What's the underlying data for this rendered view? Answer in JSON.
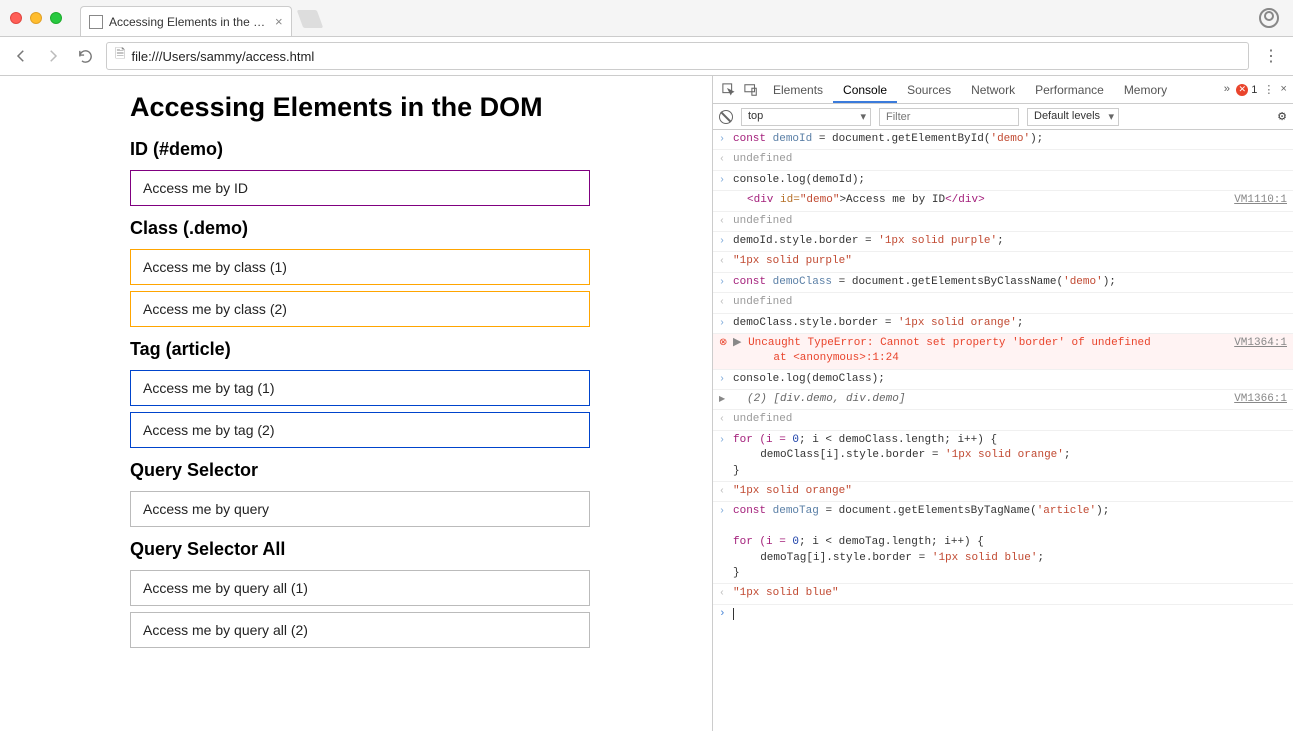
{
  "chrome": {
    "tab_title": "Accessing Elements in the DOM",
    "url": "file:///Users/sammy/access.html"
  },
  "page": {
    "h1": "Accessing Elements in the DOM",
    "sections": [
      {
        "heading": "ID (#demo)",
        "boxes": [
          {
            "text": "Access me by ID",
            "style": "purple"
          }
        ]
      },
      {
        "heading": "Class (.demo)",
        "boxes": [
          {
            "text": "Access me by class (1)",
            "style": "orange"
          },
          {
            "text": "Access me by class (2)",
            "style": "orange"
          }
        ]
      },
      {
        "heading": "Tag (article)",
        "boxes": [
          {
            "text": "Access me by tag (1)",
            "style": "blue"
          },
          {
            "text": "Access me by tag (2)",
            "style": "blue"
          }
        ]
      },
      {
        "heading": "Query Selector",
        "boxes": [
          {
            "text": "Access me by query",
            "style": ""
          }
        ]
      },
      {
        "heading": "Query Selector All",
        "boxes": [
          {
            "text": "Access me by query all (1)",
            "style": ""
          },
          {
            "text": "Access me by query all (2)",
            "style": ""
          }
        ]
      }
    ]
  },
  "devtools": {
    "tabs": [
      "Elements",
      "Console",
      "Sources",
      "Network",
      "Performance",
      "Memory"
    ],
    "active_tab": 1,
    "error_count": "1",
    "filter": {
      "context": "top",
      "placeholder": "Filter",
      "levels": "Default levels"
    },
    "source_links": {
      "vm1110": "VM1110:1",
      "vm1364": "VM1364:1",
      "vm1366": "VM1366:1"
    },
    "tokens": {
      "const": "const",
      "demoId": "demoId",
      "eq": " = document.getElementById(",
      "demo_str": "'demo'",
      "close_paren": ");",
      "undefined": "undefined",
      "log_demoId": "console.log(demoId);",
      "div_open": "<div ",
      "id_attr": "id=",
      "demo_attrv": "\"demo\"",
      "div_text": ">Access me by ID",
      "div_close": "</div>",
      "border_purple_stmt": "demoId.style.border = ",
      "purple_str": "'1px solid purple'",
      "semi": ";",
      "result_purple": "\"1px solid purple\"",
      "demoClass": "demoClass",
      "byClass": " = document.getElementsByClassName(",
      "demoClass_border": "demoClass.style.border = ",
      "orange_str": "'1px solid orange'",
      "err_line1": "Uncaught TypeError: Cannot set property 'border' of undefined",
      "err_line2": "    at <anonymous>:1:24",
      "log_demoClass": "console.log(demoClass);",
      "arr_open": "(2) ",
      "arr_body": "[div.demo, div.demo]",
      "for_open": "for (i = ",
      "zero": "0",
      "for_mid": "; i < demoClass.length; i++) {",
      "for_body": "  demoClass[i].style.border = ",
      "for_close": "}",
      "result_orange": "\"1px solid orange\"",
      "demoTag": "demoTag",
      "byTag": " = document.getElementsByTagName(",
      "article_str": "'article'",
      "for_mid2": "; i < demoTag.length; i++) {",
      "for_body2": "  demoTag[i].style.border = ",
      "blue_str": "'1px solid blue'",
      "result_blue": "\"1px solid blue\""
    }
  }
}
